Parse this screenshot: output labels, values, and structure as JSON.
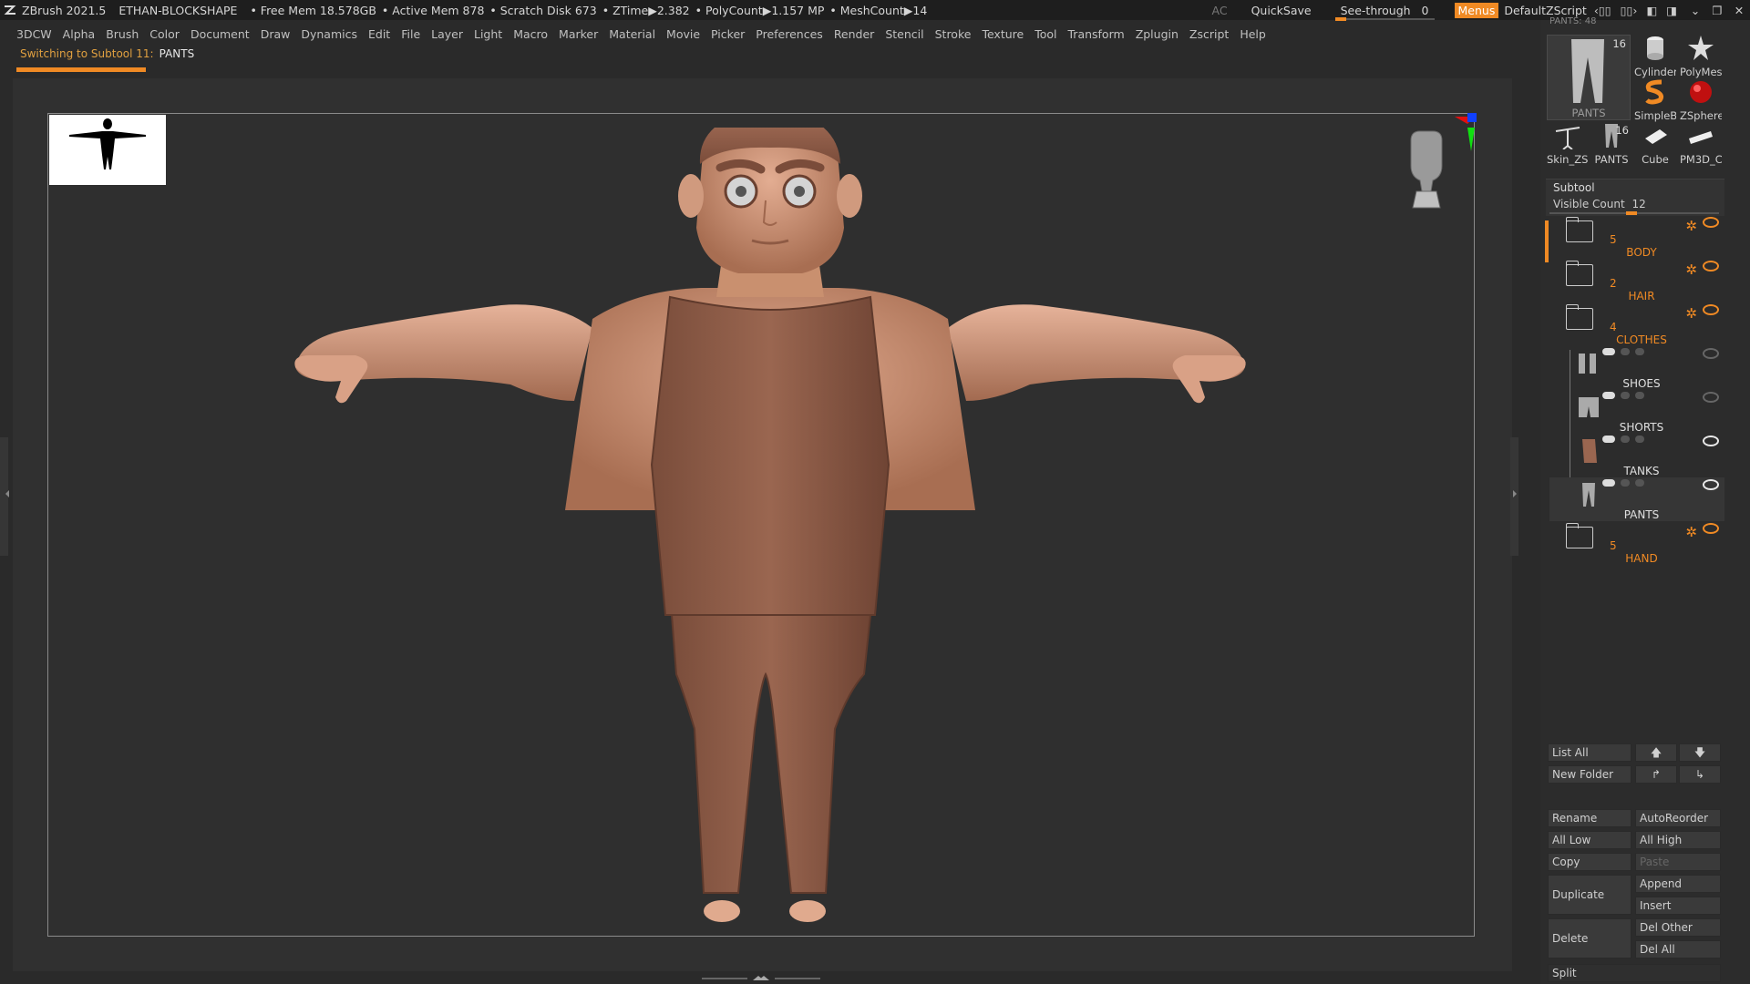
{
  "titlebar": {
    "app": "ZBrush 2021.5",
    "project": "ETHAN-BLOCKSHAPE",
    "free_mem": "• Free Mem 18.578GB",
    "active_mem": "• Active Mem 878",
    "scratch": "• Scratch Disk 673",
    "ztime": "• ZTime▶2.382",
    "polycount": "• PolyCount▶1.157 MP",
    "meshcount": "• MeshCount▶14",
    "ac": "AC",
    "quicksave": "QuickSave",
    "seethrough": "See-through",
    "seethrough_value": "0",
    "menus": "Menus",
    "script": "DefaultZScript"
  },
  "menu": [
    "3DCW",
    "Alpha",
    "Brush",
    "Color",
    "Document",
    "Draw",
    "Dynamics",
    "Edit",
    "File",
    "Layer",
    "Light",
    "Macro",
    "Marker",
    "Material",
    "Movie",
    "Picker",
    "Preferences",
    "Render",
    "Stencil",
    "Stroke",
    "Texture",
    "Tool",
    "Transform",
    "Zplugin",
    "Zscript",
    "Help"
  ],
  "notice": {
    "text": "Switching to Subtool 11:",
    "subtool": "PANTS"
  },
  "tool_palette": {
    "header": "PANTS: 48",
    "main": {
      "label": "PANTS",
      "count": "16"
    },
    "items": [
      {
        "label": "Cylinder"
      },
      {
        "label": "PolyMes"
      },
      {
        "label": "SimpleB"
      },
      {
        "label": "ZSphere"
      },
      {
        "label": "Skin_ZSp"
      },
      {
        "label": "PANTS",
        "count": "16"
      },
      {
        "label": "Cube"
      },
      {
        "label": "PM3D_C"
      }
    ]
  },
  "subtool": {
    "title": "Subtool",
    "visible_count_label": "Visible Count",
    "visible_count": "12",
    "rows": [
      {
        "count": "5",
        "name": "BODY"
      },
      {
        "count": "2",
        "name": "HAIR"
      },
      {
        "count": "4",
        "name": "CLOTHES"
      },
      {
        "name": "SHOES"
      },
      {
        "name": "SHORTS"
      },
      {
        "name": "TANKS"
      },
      {
        "name": "PANTS"
      },
      {
        "count": "5",
        "name": "HAND"
      }
    ]
  },
  "buttons": {
    "list_all": "List All",
    "new_folder": "New Folder",
    "rename": "Rename",
    "auto_reorder": "AutoReorder",
    "all_low": "All Low",
    "all_high": "All High",
    "copy": "Copy",
    "paste": "Paste",
    "duplicate": "Duplicate",
    "append": "Append",
    "insert": "Insert",
    "delete": "Delete",
    "del_other": "Del Other",
    "del_all": "Del All",
    "split": "Split"
  },
  "colors": {
    "accent": "#f08a24",
    "skin": "#c58b6e",
    "cloth": "#8a5a45"
  }
}
